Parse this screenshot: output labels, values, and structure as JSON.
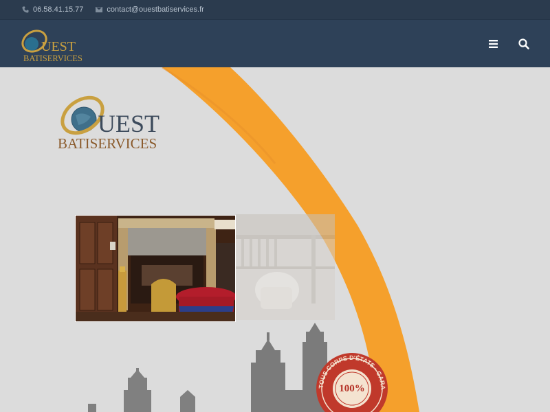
{
  "topbar": {
    "phone": "06.58.41.15.77",
    "email": "contact@ouestbatiservices.fr"
  },
  "brand": {
    "name_main": "UEST",
    "name_sub": "BATISERVICES",
    "logo_letter": "O"
  },
  "navbar": {
    "menu_icon": "hamburger-icon",
    "search_icon": "search-icon"
  },
  "badge": {
    "percent": "100%",
    "arc_text": "TOUS CORPS D'ÉTATS · GARANTIE DÉCENNALE"
  },
  "colors": {
    "topbar_bg": "#2b3b4e",
    "navbar_bg": "#2e4158",
    "accent_orange": "#f5a02c",
    "logo_gold": "#c9a040",
    "logo_brown": "#8a5a2b",
    "logo_slate": "#3d4b5c",
    "badge_red": "#c0392b"
  }
}
